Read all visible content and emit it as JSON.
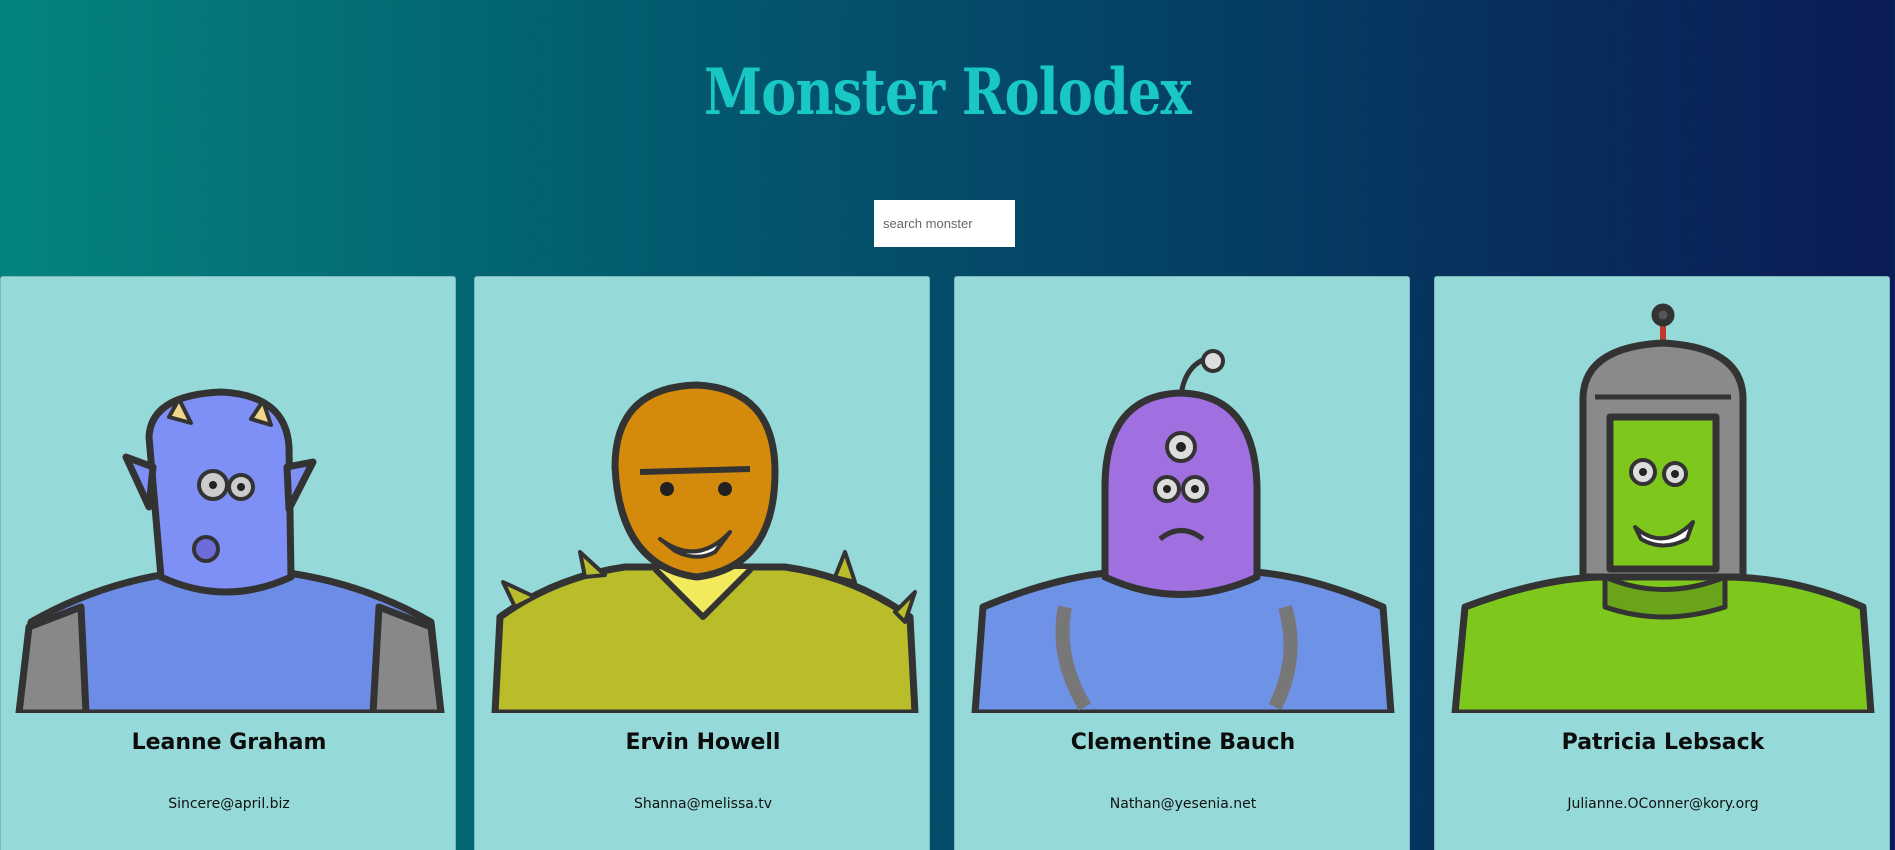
{
  "header": {
    "title": "Monster Rolodex"
  },
  "search": {
    "placeholder": "search monster",
    "value": ""
  },
  "monsters": [
    {
      "name": "Leanne Graham",
      "email": "Sincere@april.biz",
      "color": "#7e8ff5",
      "icon": "horned-blue-monster-icon"
    },
    {
      "name": "Ervin Howell",
      "email": "Shanna@melissa.tv",
      "color": "#d48a0a",
      "icon": "orange-spiky-monster-icon"
    },
    {
      "name": "Clementine Bauch",
      "email": "Nathan@yesenia.net",
      "color": "#a06fe0",
      "icon": "three-eyed-purple-monster-icon"
    },
    {
      "name": "Patricia Lebsack",
      "email": "Julianne.OConner@kory.org",
      "color": "#7ec81e",
      "icon": "green-helmet-monster-icon"
    }
  ],
  "colors": {
    "title": "#19c8c4",
    "card_background": "#95dad9",
    "gradient_start": "#04847f",
    "gradient_end": "#0b1b55"
  }
}
